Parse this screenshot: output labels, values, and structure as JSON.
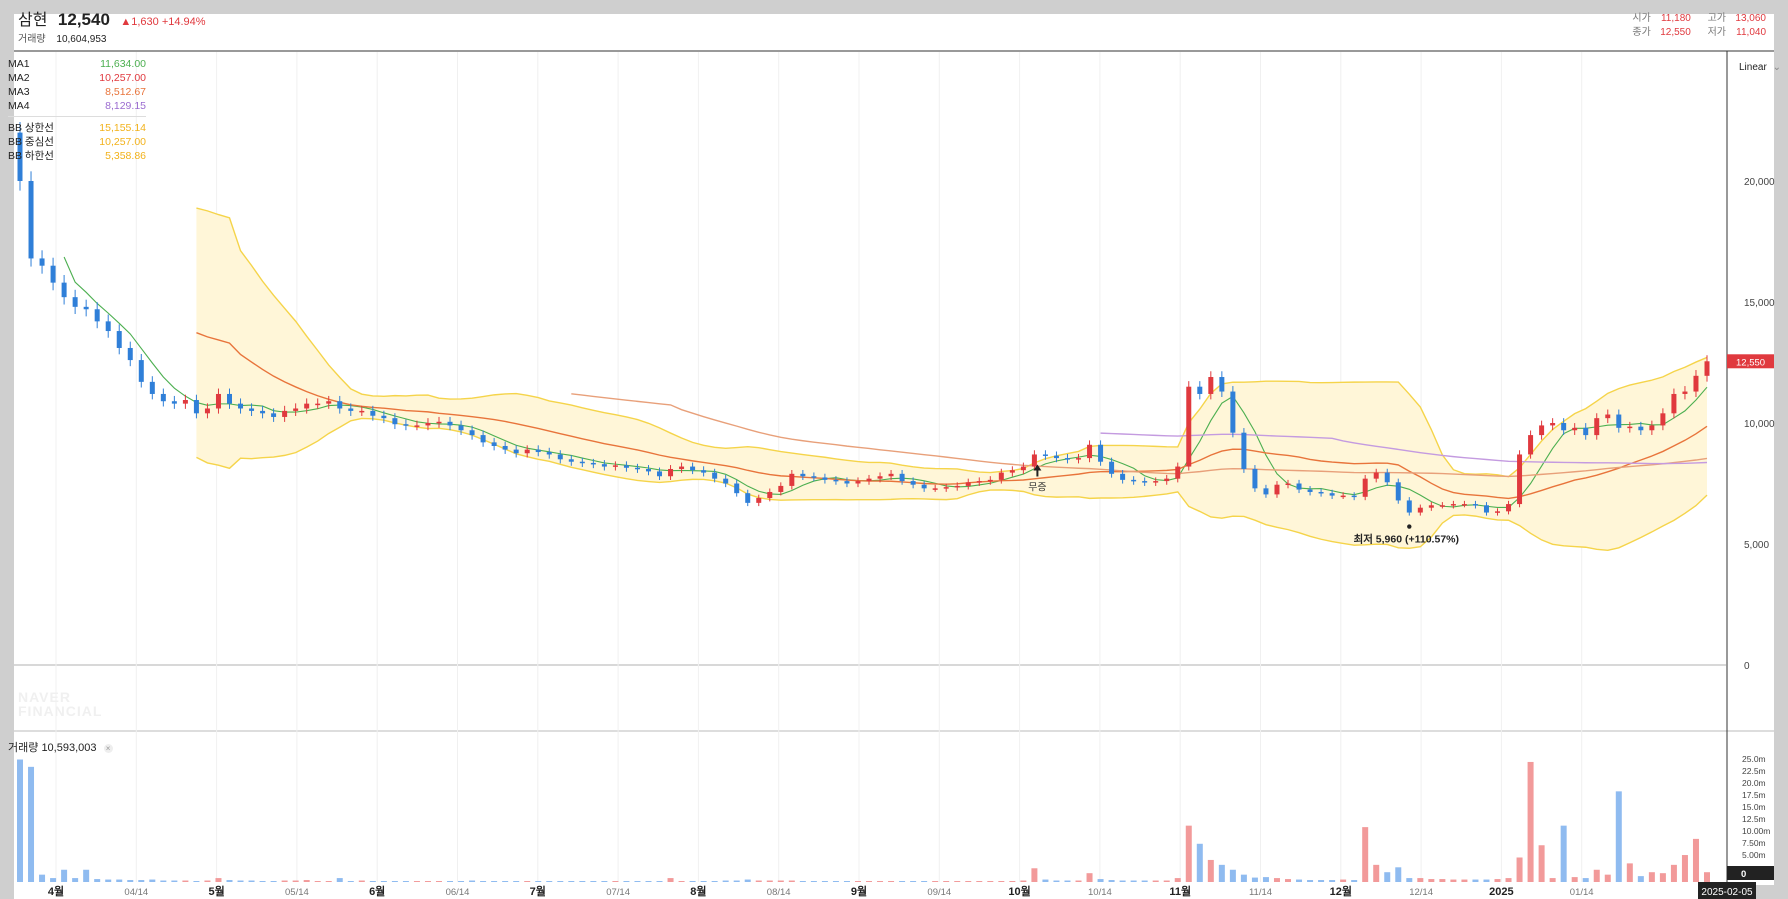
{
  "stock": {
    "name": "삼현",
    "price": "12,540",
    "change": "▲1,630 +14.94%",
    "volume_label": "거래량",
    "volume_value": "10,604,953"
  },
  "ohlc": {
    "open_label": "시가",
    "open_value": "11,180",
    "high_label": "고가",
    "high_value": "13,060",
    "close_label": "종가",
    "close_value": "12,550",
    "low_label": "저가",
    "low_value": "11,040"
  },
  "legend": {
    "ma": [
      {
        "name": "MA1",
        "value": "11,634.00",
        "color": "#4caf50"
      },
      {
        "name": "MA2",
        "value": "10,257.00",
        "color": "#e0393e"
      },
      {
        "name": "MA3",
        "value": "8,512.67",
        "color": "#e8743b"
      },
      {
        "name": "MA4",
        "value": "8,129.15",
        "color": "#9b6bd0"
      }
    ],
    "bb": [
      {
        "name": "BB 상한선",
        "value": "15,155.14",
        "color": "#f2b21b"
      },
      {
        "name": "BB 중심선",
        "value": "10,257.00",
        "color": "#f2b21b"
      },
      {
        "name": "BB 하한선",
        "value": "5,358.86",
        "color": "#f2b21b"
      }
    ]
  },
  "scale_mode": "Linear",
  "volume_header": {
    "label": "거래량",
    "value": "10,593,003"
  },
  "watermark": [
    "NAVER",
    "FINANCIAL"
  ],
  "current_price_tag": "12,550",
  "last_date_tag": "2025-02-05",
  "colors": {
    "up": "#e0393e",
    "down": "#2f7fd8",
    "up_vol": "#f29a9a",
    "down_vol": "#8fbbf0",
    "band_fill": "#fff6d8",
    "band_line": "#f5d44a"
  },
  "chart_data": {
    "type": "candlestick",
    "y_ticks": [
      0,
      5000,
      10000,
      15000,
      20000
    ],
    "y_tick_labels": [
      "0",
      "5,000",
      "10,000",
      "15,000",
      "20,000"
    ],
    "volume_ticks": [
      "25.0m",
      "22.5m",
      "20.0m",
      "17.5m",
      "15.0m",
      "12.5m",
      "10.00m",
      "7.50m",
      "5.00m"
    ],
    "x_labels": [
      {
        "label": "4월",
        "major": true
      },
      {
        "label": "04/14",
        "major": false
      },
      {
        "label": "5월",
        "major": true
      },
      {
        "label": "05/14",
        "major": false
      },
      {
        "label": "6월",
        "major": true
      },
      {
        "label": "06/14",
        "major": false
      },
      {
        "label": "7월",
        "major": true
      },
      {
        "label": "07/14",
        "major": false
      },
      {
        "label": "8월",
        "major": true
      },
      {
        "label": "08/14",
        "major": false
      },
      {
        "label": "9월",
        "major": true
      },
      {
        "label": "09/14",
        "major": false
      },
      {
        "label": "10월",
        "major": true
      },
      {
        "label": "10/14",
        "major": false
      },
      {
        "label": "11월",
        "major": true
      },
      {
        "label": "11/14",
        "major": false
      },
      {
        "label": "12월",
        "major": true
      },
      {
        "label": "12/14",
        "major": false
      },
      {
        "label": "2025",
        "major": true
      },
      {
        "label": "01/14",
        "major": false
      }
    ],
    "close": [
      20000,
      16800,
      16500,
      15800,
      15200,
      14800,
      14700,
      14200,
      13800,
      13100,
      12600,
      11700,
      11200,
      10900,
      10800,
      10950,
      10400,
      10600,
      11200,
      10800,
      10600,
      10500,
      10400,
      10250,
      10500,
      10600,
      10800,
      10800,
      10900,
      10600,
      10500,
      10500,
      10300,
      10200,
      9950,
      9900,
      9900,
      10000,
      10050,
      9900,
      9700,
      9500,
      9200,
      9050,
      8900,
      8750,
      8900,
      8800,
      8700,
      8500,
      8400,
      8350,
      8300,
      8200,
      8250,
      8150,
      8100,
      8000,
      7800,
      8100,
      8200,
      8050,
      7950,
      7700,
      7500,
      7100,
      6700,
      6900,
      7150,
      7400,
      7900,
      7800,
      7750,
      7650,
      7600,
      7500,
      7600,
      7700,
      7800,
      7900,
      7600,
      7450,
      7300,
      7300,
      7350,
      7400,
      7550,
      7600,
      7650,
      7950,
      8050,
      8200,
      8700,
      8650,
      8550,
      8500,
      8550,
      9100,
      8400,
      7900,
      7650,
      7600,
      7550,
      7600,
      7700,
      8200,
      11500,
      11200,
      11900,
      11300,
      9600,
      8100,
      7300,
      7050,
      7450,
      7500,
      7250,
      7150,
      7100,
      7000,
      7000,
      6950,
      7700,
      7950,
      7550,
      6800,
      6300,
      6500,
      6600,
      6600,
      6650,
      6650,
      6600,
      6300,
      6350,
      6650,
      8700,
      9500,
      9900,
      10000,
      9700,
      9800,
      9500,
      10200,
      10350,
      9800,
      9850,
      9700,
      9900,
      10400,
      11200,
      11300,
      11950,
      12550
    ],
    "volume_m": [
      25,
      23.5,
      1.5,
      0.8,
      2.5,
      0.8,
      2.5,
      0.6,
      0.5,
      0.5,
      0.4,
      0.4,
      0.5,
      0.3,
      0.3,
      0.3,
      0.2,
      0.3,
      0.8,
      0.4,
      0.3,
      0.3,
      0.2,
      0.2,
      0.3,
      0.3,
      0.4,
      0.2,
      0.2,
      0.8,
      0.2,
      0.3,
      0.2,
      0.2,
      0.2,
      0.2,
      0.2,
      0.2,
      0.2,
      0.2,
      0.2,
      0.3,
      0.2,
      0.2,
      0.2,
      0.2,
      0.2,
      0.2,
      0.2,
      0.2,
      0.2,
      0.2,
      0.2,
      0.2,
      0.2,
      0.2,
      0.2,
      0.2,
      0.2,
      0.8,
      0.2,
      0.2,
      0.2,
      0.2,
      0.3,
      0.3,
      0.5,
      0.3,
      0.3,
      0.3,
      0.3,
      0.2,
      0.2,
      0.2,
      0.2,
      0.2,
      0.2,
      0.2,
      0.2,
      0.2,
      0.2,
      0.2,
      0.2,
      0.2,
      0.2,
      0.2,
      0.2,
      0.2,
      0.2,
      0.2,
      0.2,
      0.3,
      2.8,
      0.5,
      0.3,
      0.3,
      0.3,
      1.8,
      0.6,
      0.4,
      0.3,
      0.3,
      0.3,
      0.3,
      0.3,
      0.8,
      11.5,
      7.8,
      4.5,
      3.5,
      2.5,
      1.5,
      0.9,
      1.0,
      0.8,
      0.6,
      0.5,
      0.4,
      0.4,
      0.4,
      0.5,
      0.4,
      11.2,
      3.5,
      2.0,
      3.0,
      0.8,
      0.8,
      0.6,
      0.6,
      0.5,
      0.5,
      0.5,
      0.5,
      0.6,
      0.8,
      5.0,
      24.5,
      7.5,
      0.8,
      11.5,
      1.0,
      0.8,
      2.5,
      1.5,
      18.5,
      3.8,
      1.2,
      2.0,
      1.8,
      3.5,
      5.5,
      8.8,
      2.0,
      10.0,
      9.8
    ],
    "ma_pairs": [
      {
        "name": "MA1",
        "period": 5
      },
      {
        "name": "MA2",
        "period": 20
      },
      {
        "name": "MA3",
        "period": 60
      },
      {
        "name": "MA4",
        "period": 120
      }
    ],
    "annotations": [
      {
        "text": "최저 5,960 (+110.57%)",
        "index": 126
      },
      {
        "text": "무증",
        "index": 92
      }
    ]
  }
}
